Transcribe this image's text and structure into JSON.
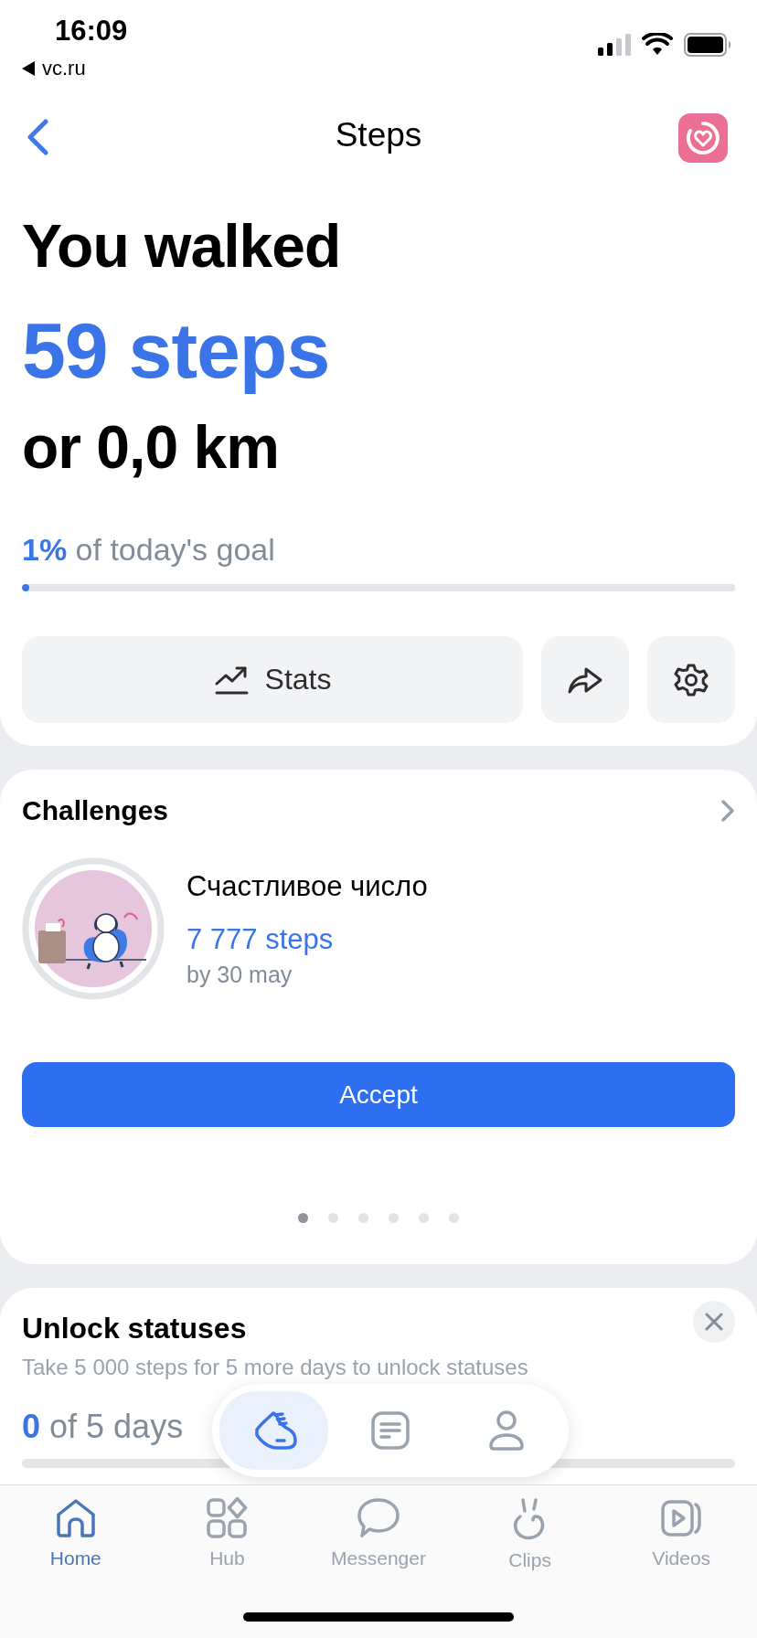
{
  "status_bar": {
    "time": "16:09",
    "back_app": "vc.ru"
  },
  "nav": {
    "title": "Steps"
  },
  "summary": {
    "headline": "You walked",
    "steps": "59 steps",
    "distance": "or 0,0 km",
    "goal": "**1%** of today's goal",
    "level": 0.01
  },
  "actions": [
    {
      "kind": "stats",
      "label": "Stats"
    },
    {
      "kind": "share"
    },
    {
      "kind": "settings"
    }
  ],
  "challenges": {
    "title": "Challenges",
    "name": "Счастливое число",
    "target": "7 777 steps",
    "deadline": "by 30 may",
    "button": "Accept",
    "pages": [
      {
        "selected": true
      },
      {
        "selected": false
      },
      {
        "selected": false
      },
      {
        "selected": false
      },
      {
        "selected": false
      },
      {
        "selected": false
      }
    ]
  },
  "unlock": {
    "title": "Unlock statuses",
    "description": "Take 5 000 steps for 5 more days to unlock statuses",
    "progress": "**0** of 5 days",
    "level": 0
  },
  "floating_tabs": [
    {
      "kind": "steps",
      "selected": true
    },
    {
      "kind": "feed",
      "selected": false
    },
    {
      "kind": "profile",
      "selected": false
    }
  ],
  "tab_bar": [
    {
      "kind": "home",
      "label": "Home",
      "selected": true
    },
    {
      "kind": "hub",
      "label": "Hub",
      "selected": false
    },
    {
      "kind": "messenger",
      "label": "Messenger",
      "selected": false
    },
    {
      "kind": "clips",
      "label": "Clips",
      "selected": false
    },
    {
      "kind": "videos",
      "label": "Videos",
      "selected": false
    }
  ]
}
